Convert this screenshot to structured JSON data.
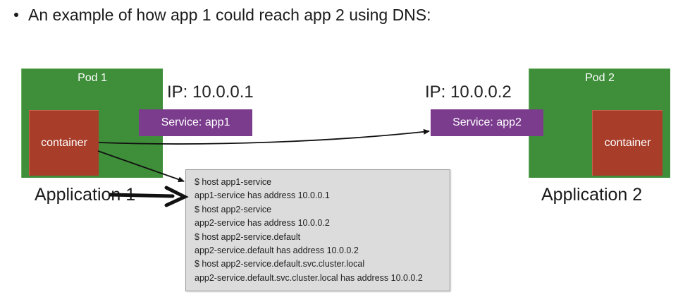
{
  "heading": {
    "text": "An example of how app 1 could reach app 2 using DNS:"
  },
  "app1": {
    "pod_label": "Pod 1",
    "container_label": "container",
    "ip_label": "IP: 10.0.0.1",
    "service_label": "Service: app1",
    "app_label": "Application 1"
  },
  "app2": {
    "pod_label": "Pod 2",
    "container_label": "container",
    "ip_label": "IP: 10.0.0.2",
    "service_label": "Service: app2",
    "app_label": "Application 2"
  },
  "terminal": {
    "lines": [
      "$ host app1-service",
      "app1-service has address 10.0.0.1",
      "$ host app2-service",
      "app2-service has address 10.0.0.2",
      "$ host app2-service.default",
      "app2-service.default has address 10.0.0.2",
      "$ host app2-service.default.svc.cluster.local",
      "app2-service.default.svc.cluster.local has address 10.0.0.2"
    ]
  },
  "colors": {
    "pod_green": "#3f8f3a",
    "container_red": "#a83d2a",
    "service_purple": "#7b3c8e",
    "terminal_gray": "#dcdcdc"
  }
}
